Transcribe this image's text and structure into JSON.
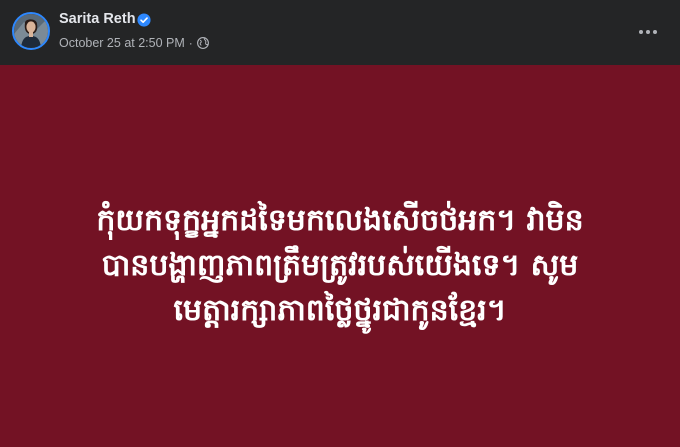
{
  "post": {
    "author": {
      "name": "Sarita Reth",
      "verified": true,
      "avatar_icon": "profile-photo"
    },
    "timestamp": "October 25 at 2:50 PM",
    "separator": "·",
    "audience_icon": "globe-icon",
    "more_icon": "ellipsis-icon",
    "background_color": "#731224",
    "text_lines": [
      "កុំយកទុក្ខអ្នកដទៃមកលេងសើចថ់អក។ វាមិន",
      "បានបង្ហាញភាពត្រឹមត្រូវរបស់យើងទេ។ សូម",
      "មេត្តារក្សាភាពថ្លៃថ្នូរជាកូនខ្មែរ។"
    ]
  },
  "colors": {
    "header_bg": "#242526",
    "name_text": "#e4e6eb",
    "meta_text": "#b0b3b8",
    "verified_badge": "#2d88ff",
    "post_text": "#ffffff"
  }
}
